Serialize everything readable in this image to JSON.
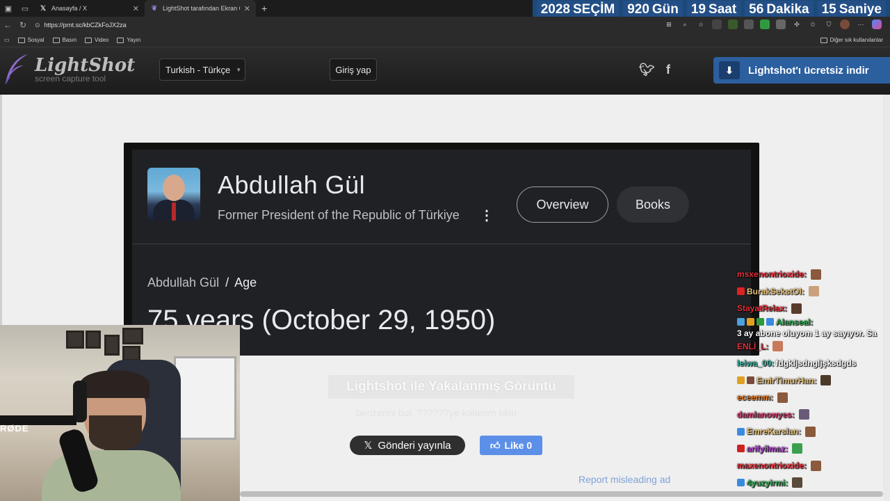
{
  "browser": {
    "tabs": [
      {
        "label": "Anasayfa / X",
        "favicon": "X"
      },
      {
        "label": "LightShot tarafından Ekran Görün",
        "favicon": "feather"
      }
    ],
    "url": "https://prnt.sc/kbCZkFoJX2za",
    "bookmarks": [
      "Sosyal",
      "Basın",
      "Video",
      "Yayın"
    ],
    "other_bookmarks": "Diğer sık kullanılanlar"
  },
  "countdown": {
    "year": "2028",
    "title": "SEÇİM",
    "days_num": "920",
    "days_unit": "Gün",
    "hours_num": "19",
    "hours_unit": "Saat",
    "minutes_num": "56",
    "minutes_unit": "Dakika",
    "seconds_num": "15",
    "seconds_unit": "Saniye"
  },
  "lightshot": {
    "logo_title": "LightShot",
    "logo_sub": "screen capture tool",
    "language": "Turkish - Türkçe",
    "login": "Giriş yap",
    "download": "Lightshot'ı ücretsiz indir"
  },
  "card": {
    "name": "Abdullah Gül",
    "subtitle": "Former President of the Republic of Türkiye",
    "tab_overview": "Overview",
    "tab_books": "Books",
    "crumb_name": "Abdullah Gül",
    "crumb_sep": "/",
    "crumb_topic": "Age",
    "answer": "75 years (October 29, 1950)"
  },
  "page": {
    "caption": "Lightshot ile Yakalanmış Görüntü",
    "caption_sub": "benzerini bul, ??????ye kalanım tıklıı",
    "x_share": "Gönderi yayınla",
    "fb_like": "Like 0",
    "report": "Report misleading ad"
  },
  "chat": [
    {
      "user": "msxenontrioxide:",
      "msg": "",
      "color": "#e0303a"
    },
    {
      "user": "BurakSekstOl:",
      "msg": "",
      "color": "#e7c27a"
    },
    {
      "user": "StayatRelax:",
      "msg": "",
      "color": "#e0303a"
    },
    {
      "user": "Alanseal:",
      "msg": "3 ay abone oluyom 1 ay sayıyor. Sa",
      "color": "#2fa84f"
    },
    {
      "user": "ENLİ_L:",
      "msg": "",
      "color": "#e0303a"
    },
    {
      "user": "leiwa_00:",
      "msg": "fdgkljsdngljşksdgds",
      "color": "#3fb7a7"
    },
    {
      "user": "EmirTimurHan:",
      "msg": "",
      "color": "#e7c27a"
    },
    {
      "user": "eceemm:",
      "msg": "",
      "color": "#e07a2a"
    },
    {
      "user": "damlanowyes:",
      "msg": "",
      "color": "#d43b6a"
    },
    {
      "user": "EmreKarslan:",
      "msg": "",
      "color": "#e7c27a"
    },
    {
      "user": "arifyilmaz:",
      "msg": "",
      "color": "#b040d0"
    },
    {
      "user": "maxenontrioxide:",
      "msg": "",
      "color": "#e0303a"
    },
    {
      "user": "4yuzyirmi:",
      "msg": "",
      "color": "#2fa84f"
    }
  ],
  "webcam": {
    "mic_brand": "RØDE"
  }
}
